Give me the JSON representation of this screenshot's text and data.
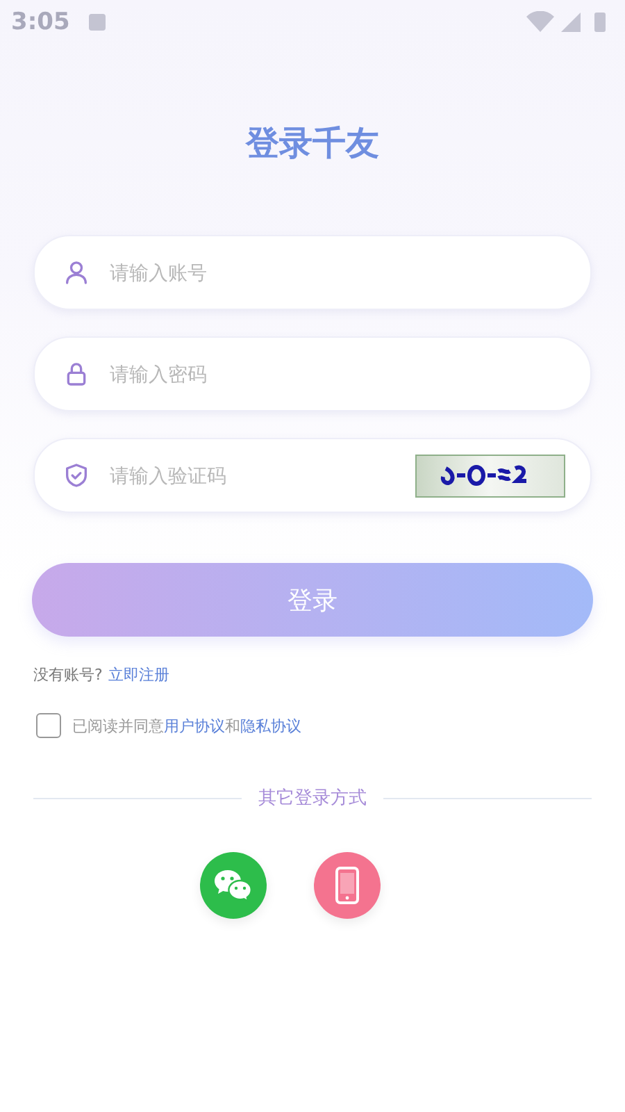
{
  "status_bar": {
    "time": "3:05"
  },
  "title": "登录千友",
  "fields": [
    {
      "kind": "account",
      "placeholder": "请输入账号"
    },
    {
      "kind": "password",
      "placeholder": "请输入密码"
    },
    {
      "kind": "captcha",
      "placeholder": "请输入验证码"
    }
  ],
  "login_button": "登录",
  "register": {
    "prompt": "没有账号?",
    "link": "立即注册"
  },
  "agreement": {
    "checked": false,
    "before": "已阅读并同意",
    "link_1": "用户协议",
    "joiner": "和",
    "link_2": "隐私协议"
  },
  "other_login": {
    "label": "其它登录方式",
    "methods": [
      {
        "kind": "wechat"
      },
      {
        "kind": "phone"
      }
    ]
  }
}
